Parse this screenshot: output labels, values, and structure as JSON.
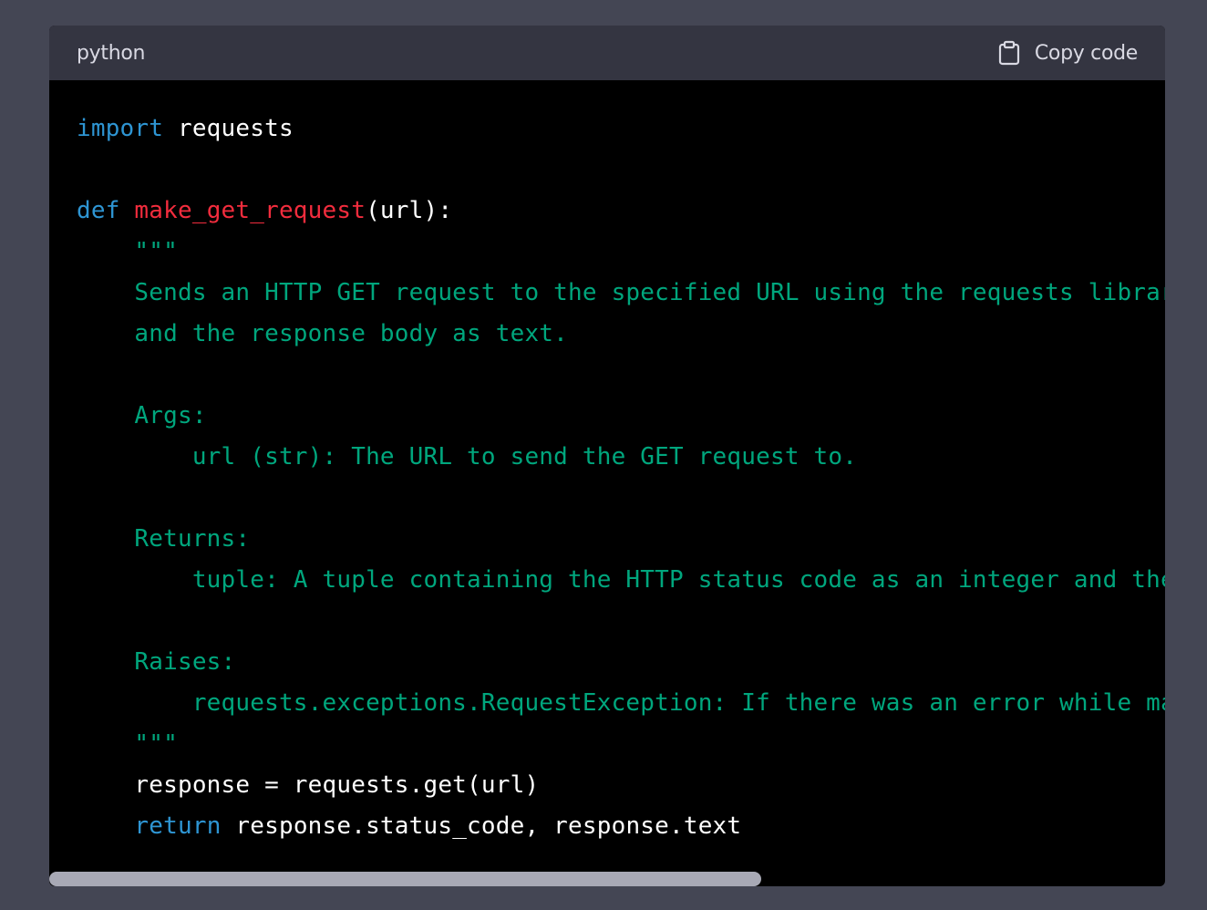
{
  "header": {
    "language": "python",
    "copy_label": "Copy code"
  },
  "icons": {
    "copy": "clipboard-icon"
  },
  "colors": {
    "keyword": "#2e95d3",
    "function": "#f22c3d",
    "string": "#00a67d",
    "text": "#ffffff",
    "header_bg": "#343541",
    "code_bg": "#000000",
    "page_bg": "#444654"
  },
  "code": {
    "l1_kw": "import",
    "l1_rest": " requests",
    "l3_kw": "def",
    "l3_fn": "make_get_request",
    "l3_rest": "(url):",
    "l4": "    \"\"\"",
    "l5": "    Sends an HTTP GET request to the specified URL using the requests library and returns the HTTP status code",
    "l6": "    and the response body as text.",
    "l8": "    Args:",
    "l9": "        url (str): The URL to send the GET request to.",
    "l11": "    Returns:",
    "l12": "        tuple: A tuple containing the HTTP status code as an integer and the response body as a string.",
    "l14": "    Raises:",
    "l15": "        requests.exceptions.RequestException: If there was an error while making the request.",
    "l16": "    \"\"\"",
    "l17": "    response = requests.get(url)",
    "l18_indent": "    ",
    "l18_kw": "return",
    "l18_rest": " response.status_code, response.text"
  }
}
